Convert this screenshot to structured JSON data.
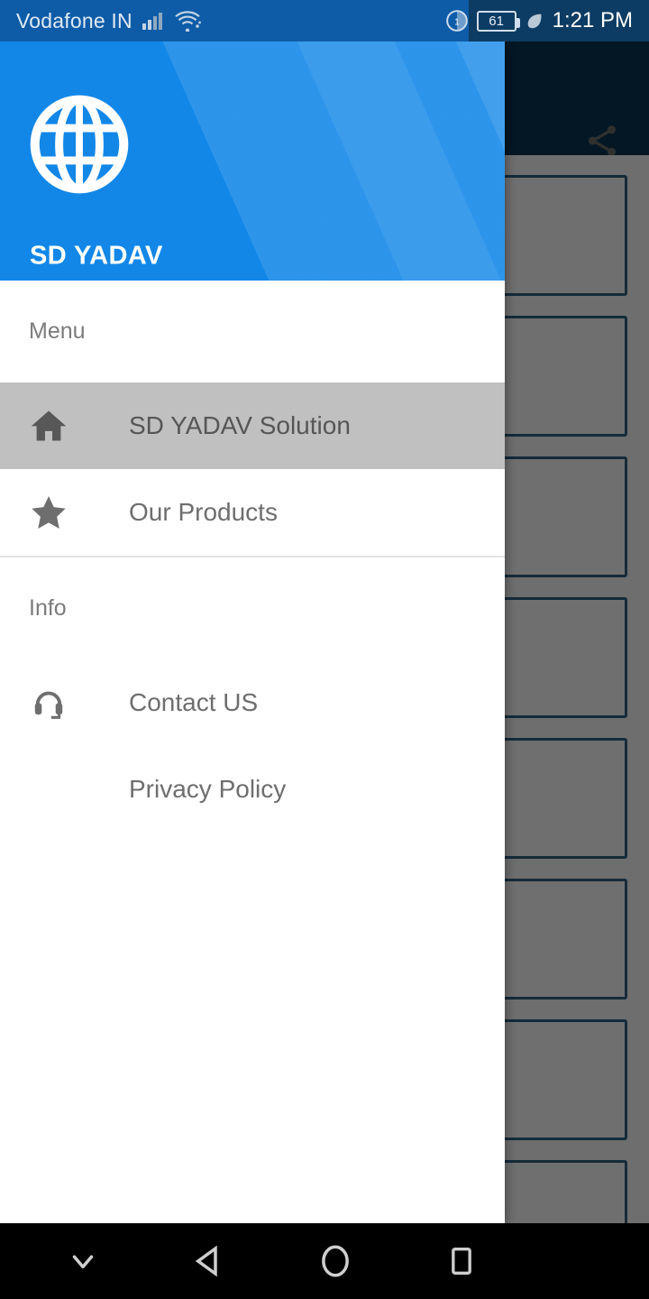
{
  "status_bar": {
    "carrier": "Vodafone IN",
    "signal_icon": "cellular-signal-icon",
    "wifi_icon": "wifi-icon",
    "alarm_icon": "do-not-disturb-icon",
    "battery_level": "61",
    "power_saving_icon": "leaf-power-saving-icon",
    "clock": "1:21 PM",
    "bg_color": "#0e5ca8"
  },
  "app_bar": {
    "share_icon": "share-icon",
    "bg_color": "#0f4c75"
  },
  "drawer": {
    "logo_icon": "globe-icon",
    "title": "SD YADAV",
    "header_color": "#1287e8",
    "sections": [
      {
        "label": "Menu",
        "items": [
          {
            "label": "SD YADAV Solution",
            "icon": "home-icon",
            "selected": true
          },
          {
            "label": "Our Products",
            "icon": "star-icon",
            "selected": false
          }
        ]
      },
      {
        "label": "Info",
        "items": [
          {
            "label": "Contact US",
            "icon": "headset-icon",
            "selected": false
          },
          {
            "label": "Privacy Policy",
            "icon": "",
            "selected": false
          }
        ]
      }
    ],
    "selected_bg": "#c0c0c0"
  },
  "background_content": {
    "card_count": 7,
    "card_border_color": "#2f5f80"
  },
  "nav_bar": {
    "buttons": [
      {
        "name": "hide-keyboard-button",
        "icon": "chevron-down-icon"
      },
      {
        "name": "back-button",
        "icon": "triangle-back-icon"
      },
      {
        "name": "home-button",
        "icon": "circle-home-icon"
      },
      {
        "name": "recents-button",
        "icon": "square-recents-icon"
      }
    ]
  }
}
